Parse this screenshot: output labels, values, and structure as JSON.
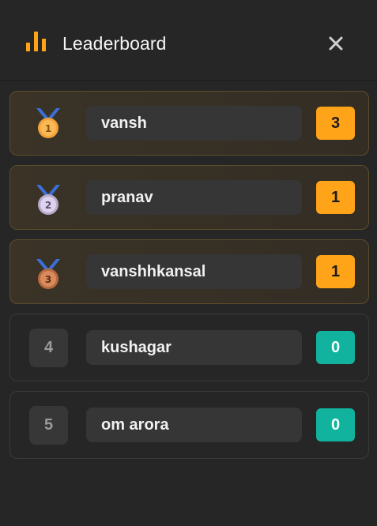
{
  "header": {
    "title": "Leaderboard",
    "icon": "bar-chart-icon",
    "close_icon": "close-icon",
    "accent_color": "#ffa319"
  },
  "entries": [
    {
      "rank": "1",
      "name": "vansh",
      "score": "3",
      "medal": "gold-medal-icon"
    },
    {
      "rank": "2",
      "name": "pranav",
      "score": "1",
      "medal": "silver-medal-icon"
    },
    {
      "rank": "3",
      "name": "vanshhkansal",
      "score": "1",
      "medal": "bronze-medal-icon"
    },
    {
      "rank": "4",
      "name": "kushagar",
      "score": "0"
    },
    {
      "rank": "5",
      "name": "om arora",
      "score": "0"
    }
  ],
  "colors": {
    "score_positive": "#ffa319",
    "score_zero": "#11b39f",
    "medal_ribbon": "#3b6fd8"
  }
}
